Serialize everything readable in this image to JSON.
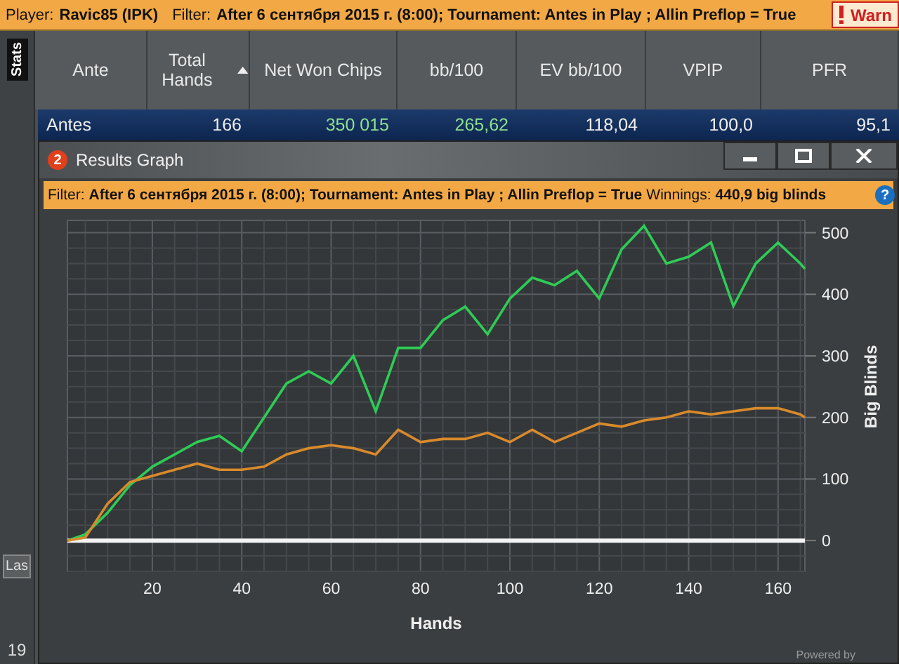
{
  "top_bar": {
    "player_label": "Player:",
    "player": "Ravic85 (IPK)",
    "filter_label": "Filter:",
    "filter": "After 6 сентября 2015 г. (8:00); Tournament: Antes in Play ; Allin Preflop = True",
    "warning": "Warn"
  },
  "side_tab": {
    "label": "Stats"
  },
  "table": {
    "columns": [
      {
        "label": "Ante",
        "sorted": false
      },
      {
        "label": "Total Hands",
        "sorted": true
      },
      {
        "label": "Net Won Chips",
        "sorted": false
      },
      {
        "label": "bb/100",
        "sorted": false
      },
      {
        "label": "EV bb/100",
        "sorted": false
      },
      {
        "label": "VPIP",
        "sorted": false
      },
      {
        "label": "PFR",
        "sorted": false
      }
    ],
    "rows": [
      {
        "selected": true,
        "cells": [
          {
            "text": "Antes",
            "kind": "label"
          },
          {
            "text": "166",
            "kind": "plain"
          },
          {
            "text": "350 015",
            "kind": "positive"
          },
          {
            "text": "265,62",
            "kind": "positive"
          },
          {
            "text": "118,04",
            "kind": "plain"
          },
          {
            "text": "100,0",
            "kind": "plain"
          },
          {
            "text": "95,1",
            "kind": "plain"
          }
        ]
      }
    ]
  },
  "left_panel": {
    "field_value": "Las",
    "row_number": "19"
  },
  "graph_window": {
    "badge": "2",
    "title": "Results Graph",
    "filter_label": "Filter:",
    "filter": "After 6 сентября 2015 г. (8:00); Tournament: Antes in Play ; Allin Preflop = True",
    "winnings_label": "Winnings:",
    "winnings": "440,9 big blinds",
    "help": "?",
    "footer": "Powered by",
    "chart_data": {
      "type": "line",
      "grid": true,
      "xlabel": "Hands",
      "ylabel": "Big Blinds",
      "xlim": [
        1,
        166
      ],
      "ylim": [
        -50,
        520
      ],
      "xticks": [
        20,
        40,
        60,
        80,
        100,
        120,
        140,
        160
      ],
      "yticks": [
        0,
        100,
        200,
        300,
        400,
        500
      ],
      "x": [
        1,
        5,
        10,
        15,
        20,
        25,
        30,
        35,
        40,
        45,
        50,
        55,
        60,
        65,
        70,
        75,
        80,
        85,
        90,
        95,
        100,
        105,
        110,
        115,
        120,
        125,
        130,
        135,
        140,
        145,
        150,
        155,
        160,
        165,
        166
      ],
      "series": [
        {
          "color": "#2ecc55",
          "values": [
            0,
            10,
            45,
            90,
            120,
            140,
            160,
            170,
            145,
            200,
            255,
            275,
            255,
            300,
            210,
            313,
            313,
            358,
            380,
            335,
            393,
            427,
            415,
            438,
            393,
            473,
            511,
            450,
            461,
            484,
            381,
            450,
            484,
            450,
            441
          ]
        },
        {
          "color": "#d98a2b",
          "values": [
            0,
            5,
            60,
            95,
            105,
            115,
            125,
            115,
            115,
            120,
            140,
            150,
            155,
            150,
            140,
            180,
            160,
            165,
            165,
            175,
            160,
            180,
            160,
            175,
            190,
            185,
            195,
            200,
            210,
            205,
            210,
            215,
            215,
            205,
            200
          ]
        }
      ]
    }
  }
}
